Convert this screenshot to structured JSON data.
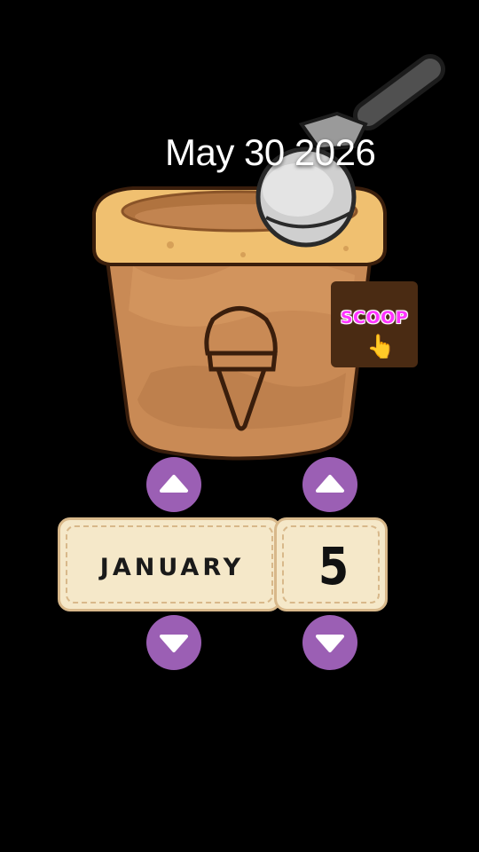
{
  "header": {
    "date": "May 30 2026"
  },
  "scoop_button": {
    "label": "SCOOP",
    "icon": "pointing-hand-icon"
  },
  "picker": {
    "month": "JANUARY",
    "day": "5"
  },
  "controls": {
    "month_up_icon": "chevron-up-icon",
    "month_down_icon": "chevron-down-icon",
    "day_up_icon": "chevron-up-icon",
    "day_down_icon": "chevron-down-icon"
  },
  "colors": {
    "background": "#000000",
    "arrow_button": "#9b5fb4",
    "picker_fill": "#f5e8c9",
    "picker_border": "#d8b88a",
    "scoop_bg": "#4a2b13",
    "scoop_text": "#ff33ff",
    "cup_body": "#c98a55",
    "cup_rim": "#f0c070"
  }
}
